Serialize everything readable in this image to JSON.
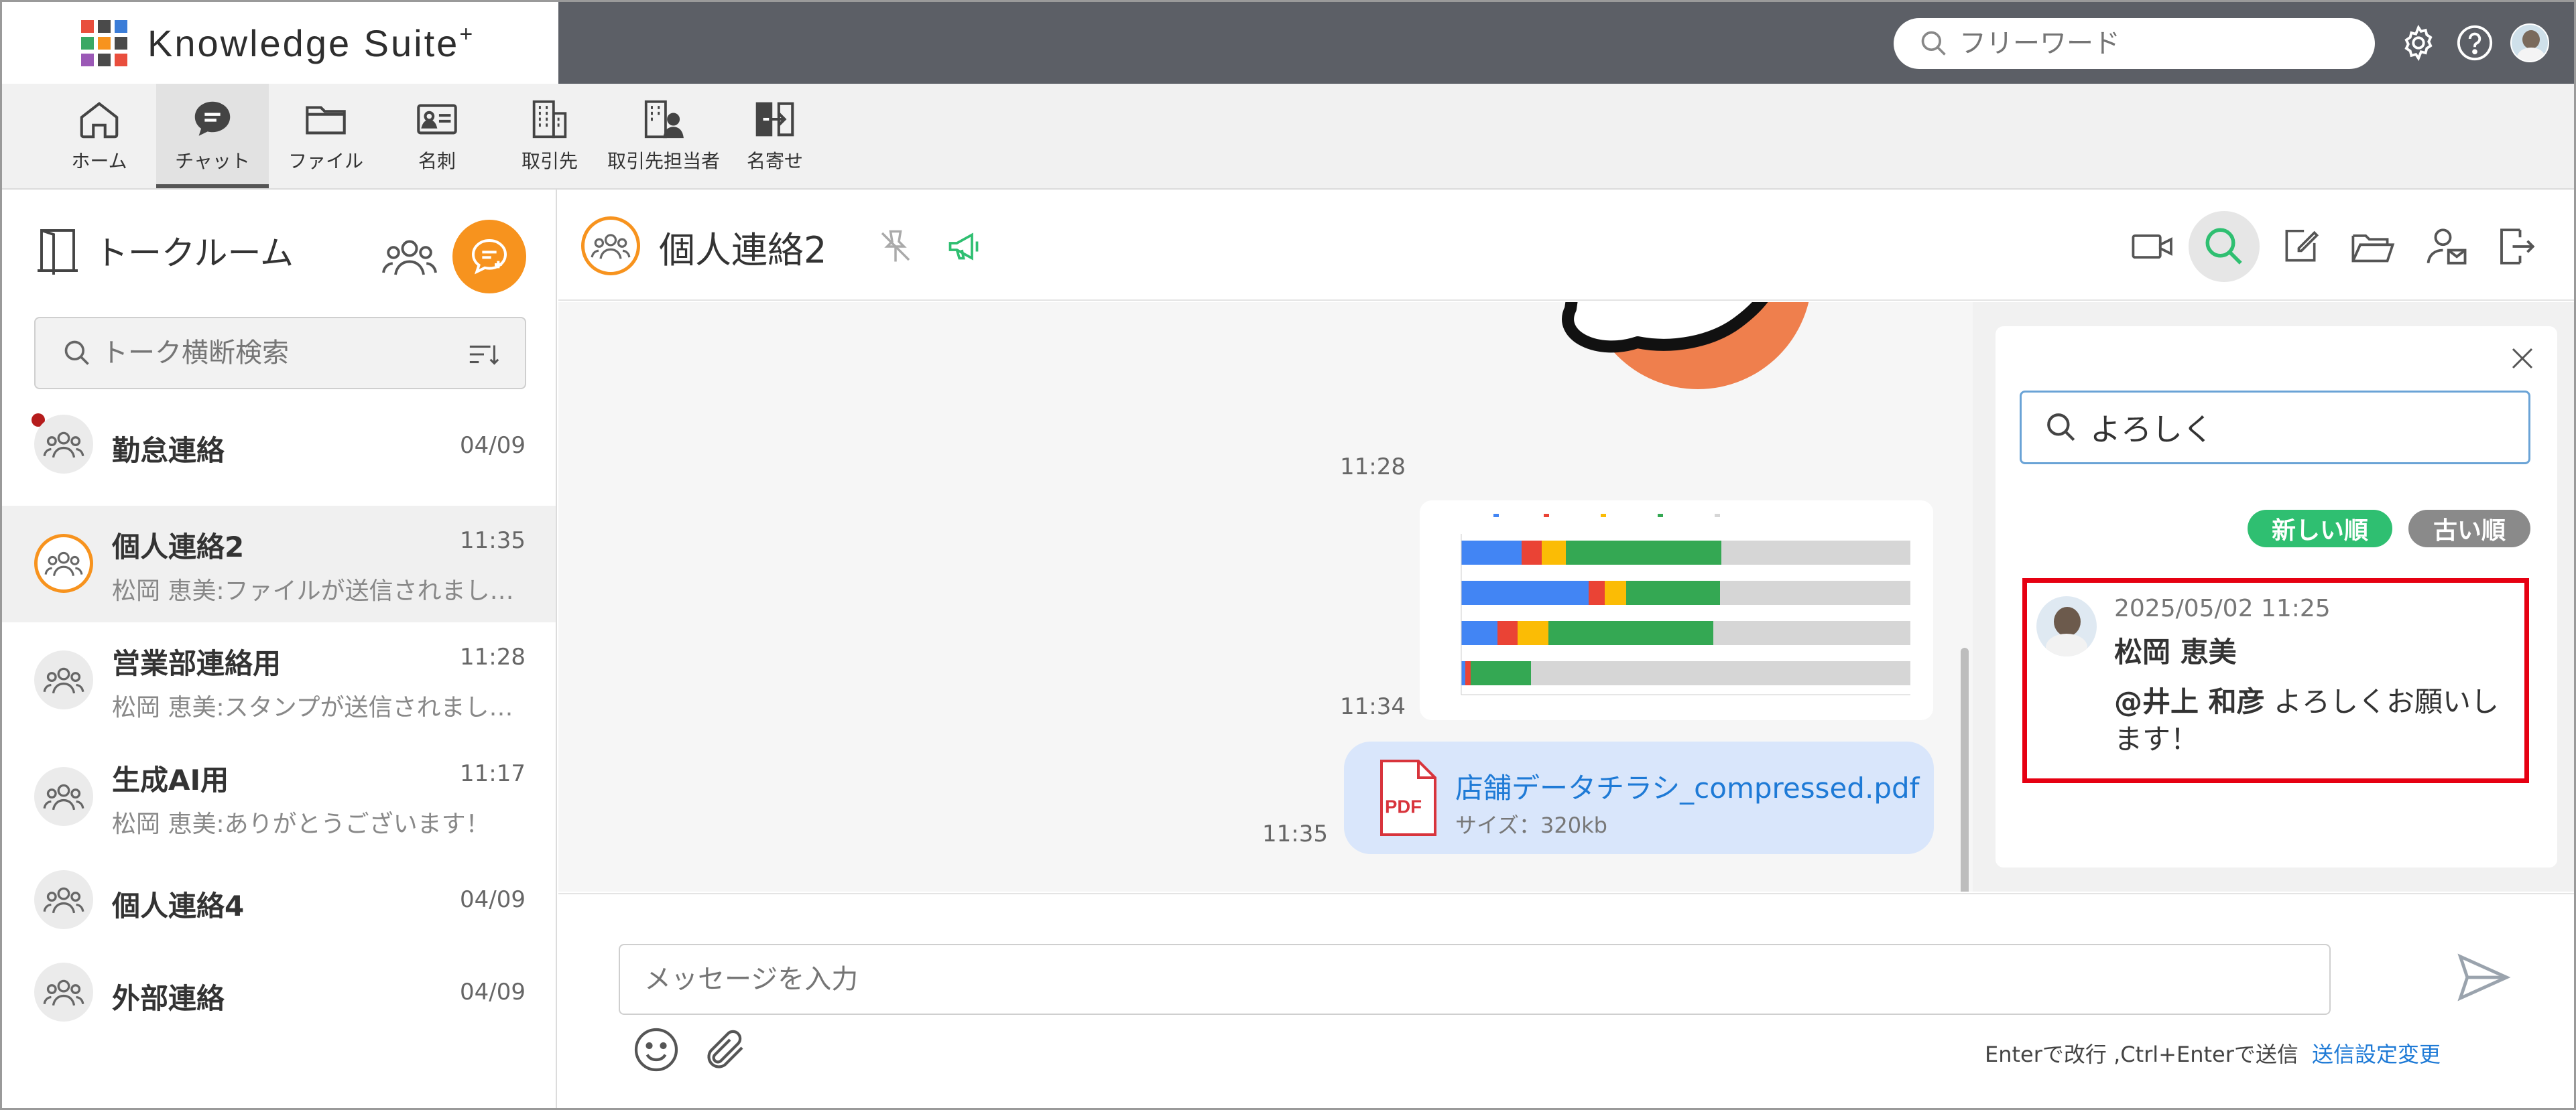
{
  "app": {
    "title": "Knowledge Suite",
    "title_sup": "+",
    "logo_colors": [
      "#e94e3d",
      "#4a4a4a",
      "#3b7dd8",
      "#3aa864",
      "#f7931e",
      "#4a4a4a",
      "#9b59b6",
      "#4a4a4a",
      "#e94e3d"
    ]
  },
  "topbar": {
    "search_placeholder": "フリーワード",
    "icons": [
      "gear-icon",
      "help-icon",
      "avatar"
    ]
  },
  "nav": {
    "items": [
      {
        "label": "ホーム",
        "icon": "home-icon"
      },
      {
        "label": "チャット",
        "icon": "chat-icon",
        "active": true
      },
      {
        "label": "ファイル",
        "icon": "folder-icon"
      },
      {
        "label": "名刺",
        "icon": "business-card-icon"
      },
      {
        "label": "取引先",
        "icon": "building-icon"
      },
      {
        "label": "取引先担当者",
        "icon": "contact-person-icon"
      },
      {
        "label": "名寄せ",
        "icon": "merge-icon"
      }
    ]
  },
  "sidebar": {
    "title": "トークルーム",
    "search_placeholder": "トーク横断検索",
    "rooms": [
      {
        "name": "勤怠連絡",
        "time": "04/09",
        "preview": "",
        "unread": true
      },
      {
        "name": "個人連絡2",
        "time": "11:35",
        "preview": "松岡 恵美:ファイルが送信されまし…",
        "active": true
      },
      {
        "name": "営業部連絡用",
        "time": "11:28",
        "preview": "松岡 恵美:スタンプが送信されまし…"
      },
      {
        "name": "生成AI用",
        "time": "11:17",
        "preview": "松岡 恵美:ありがとうございます！"
      },
      {
        "name": "個人連絡4",
        "time": "04/09",
        "preview": ""
      },
      {
        "name": "外部連絡",
        "time": "04/09",
        "preview": ""
      }
    ]
  },
  "chat": {
    "title": "個人連絡2",
    "accent_color": "#f7931e",
    "messages": [
      {
        "time": "11:28",
        "type": "stamp"
      },
      {
        "time": "11:34",
        "type": "image"
      },
      {
        "time": "11:35",
        "type": "file",
        "file_name": "店舗データチラシ_compressed.pdf",
        "file_size": "サイズ：320kb",
        "file_type": "PDF"
      }
    ]
  },
  "search_panel": {
    "query": "よろしく",
    "sort_new": "新しい順",
    "sort_old": "古い順",
    "sort_new_color": "#2fbf71",
    "sort_old_color": "#8a8a8a",
    "result": {
      "date": "2025/05/02 11:25",
      "name": "松岡 恵美",
      "mention": "@井上 和彦",
      "text": " よろしくお願いします！"
    }
  },
  "composer": {
    "placeholder": "メッセージを入力",
    "hint": "Enterで改行 ,Ctrl+Enterで送信",
    "send_setting": "送信設定変更"
  }
}
